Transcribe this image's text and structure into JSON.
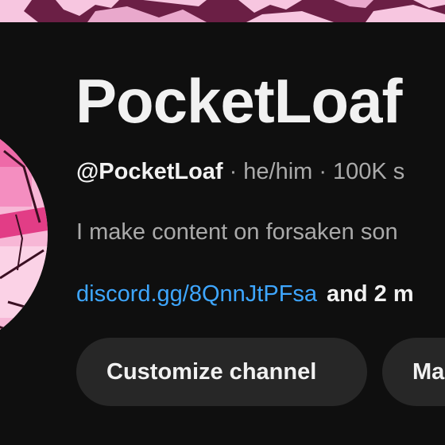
{
  "channel": {
    "name": "PocketLoaf",
    "handle": "@PocketLoaf",
    "pronouns": "he/him",
    "subscribers": "100K s",
    "separator": "·",
    "description": "I make content on forsaken son",
    "link": "discord.gg/8QnnJtPFsa",
    "more_links": "and 2 m"
  },
  "actions": {
    "customize_label": "Customize channel",
    "manage_label": "Ma"
  },
  "colors": {
    "background": "#0f0f0f",
    "text_primary": "#f1f1f1",
    "text_secondary": "#aaaaaa",
    "link": "#3ea6ff",
    "button_bg": "#272727",
    "banner_pink": "#f7c6e0",
    "banner_dark": "#6b1f45"
  }
}
